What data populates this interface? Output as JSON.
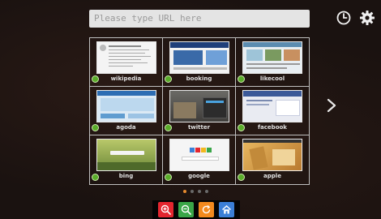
{
  "url_bar": {
    "placeholder": "Please type URL here"
  },
  "icons": {
    "history": "clock-icon",
    "settings": "gear-icon",
    "next_page": "chevron-right-icon"
  },
  "speed_dial": [
    {
      "label": "wikipedia",
      "thumb_color": "#f4f4f4"
    },
    {
      "label": "booking",
      "thumb_color": "#3a6aa8"
    },
    {
      "label": "likecool",
      "thumb_color": "#9ec4d8"
    },
    {
      "label": "agoda",
      "thumb_color": "#bcd8ee"
    },
    {
      "label": "twitter",
      "thumb_color": "#3f3d3a"
    },
    {
      "label": "facebook",
      "thumb_color": "#3b5998"
    },
    {
      "label": "bing",
      "thumb_color": "#8aa34a"
    },
    {
      "label": "google",
      "thumb_color": "#f5f5f5"
    },
    {
      "label": "apple",
      "thumb_color": "#d9a24a"
    }
  ],
  "pagination": {
    "total": 4,
    "active": 0
  },
  "toolbar": {
    "zoom_in_color": "#e3262f",
    "zoom_out_color": "#3aa648",
    "refresh_color": "#f28a1e",
    "home_color": "#3b7fd6"
  },
  "colors": {
    "badge": "#5aad2a",
    "accent_dot": "#e68a2e"
  }
}
